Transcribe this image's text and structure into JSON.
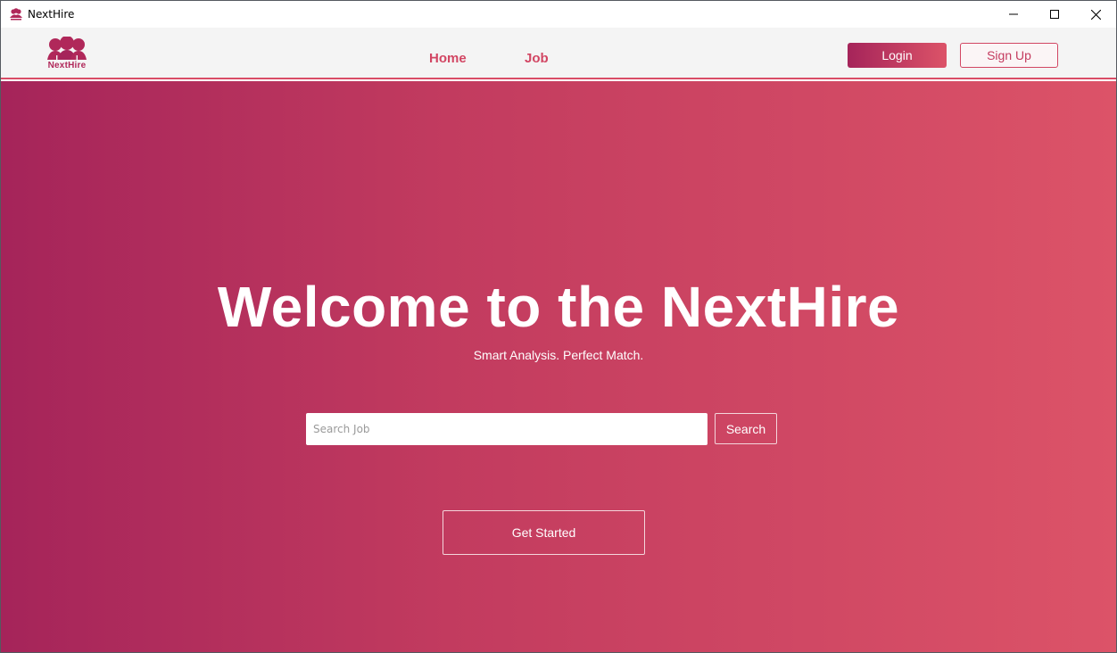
{
  "window": {
    "title": "NextHire",
    "icon": "people-group-icon"
  },
  "window_controls": [
    "minimize-icon",
    "maximize-icon",
    "close-icon"
  ],
  "navbar": {
    "logo_text": "NextHire",
    "links": [
      {
        "label": "Home"
      },
      {
        "label": "Job"
      }
    ],
    "login_label": "Login",
    "signup_label": "Sign Up"
  },
  "hero": {
    "title": "Welcome to the NextHire",
    "subtitle": "Smart Analysis. Perfect Match.",
    "search": {
      "placeholder": "Search Job",
      "value": "",
      "button_label": "Search"
    },
    "cta_label": "Get Started"
  },
  "colors": {
    "gradient_start": "#a5245a",
    "gradient_end": "#dc5368",
    "accent": "#d24663",
    "navbar_bg": "#f4f4f4"
  }
}
